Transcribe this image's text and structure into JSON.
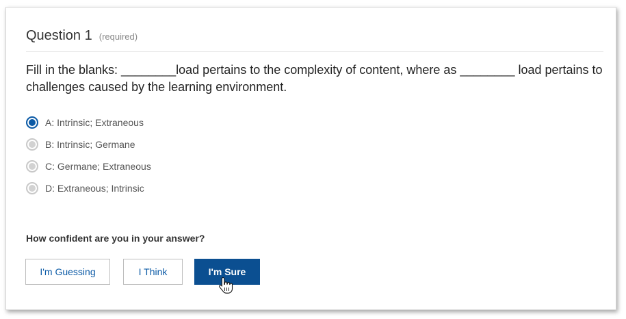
{
  "question": {
    "title": "Question 1",
    "required_label": "(required)",
    "prompt": "Fill in the blanks: ________load pertains to the complexity of content, where as ________ load pertains to challenges caused by the learning environment."
  },
  "options": [
    {
      "label": "A: Intrinsic; Extraneous",
      "selected": true
    },
    {
      "label": "B: Intrinsic; Germane",
      "selected": false
    },
    {
      "label": "C: Germane; Extraneous",
      "selected": false
    },
    {
      "label": "D: Extraneous; Intrinsic",
      "selected": false
    }
  ],
  "confidence": {
    "question": "How confident are you in your answer?",
    "buttons": {
      "guessing": "I'm Guessing",
      "think": "I Think",
      "sure": "I'm Sure"
    },
    "active": "sure"
  },
  "colors": {
    "accent": "#0b4f91",
    "radio_selected": "#0b5aa6",
    "radio_unselected": "#d2d2d2"
  },
  "icons": {
    "cursor": "hand-pointer-icon"
  }
}
